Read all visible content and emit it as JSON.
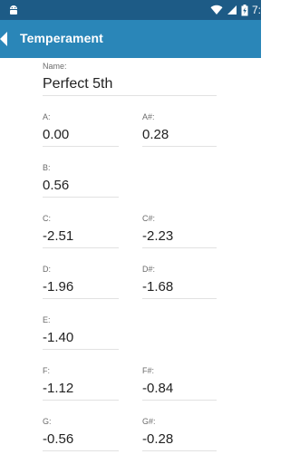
{
  "status_bar": {
    "time": "7:"
  },
  "app_bar": {
    "title": "Temperament"
  },
  "form": {
    "name_label": "Name:",
    "name_value": "Perfect 5th",
    "notes": [
      {
        "label": "A:",
        "value": "0.00"
      },
      {
        "label": "A#:",
        "value": "0.28"
      },
      {
        "label": "B:",
        "value": "0.56"
      },
      {
        "label": "C:",
        "value": "-2.51"
      },
      {
        "label": "C#:",
        "value": "-2.23"
      },
      {
        "label": "D:",
        "value": "-1.96"
      },
      {
        "label": "D#:",
        "value": "-1.68"
      },
      {
        "label": "E:",
        "value": "-1.40"
      },
      {
        "label": "F:",
        "value": "-1.12"
      },
      {
        "label": "F#:",
        "value": "-0.84"
      },
      {
        "label": "G:",
        "value": "-0.56"
      },
      {
        "label": "G#:",
        "value": "-0.28"
      }
    ]
  }
}
